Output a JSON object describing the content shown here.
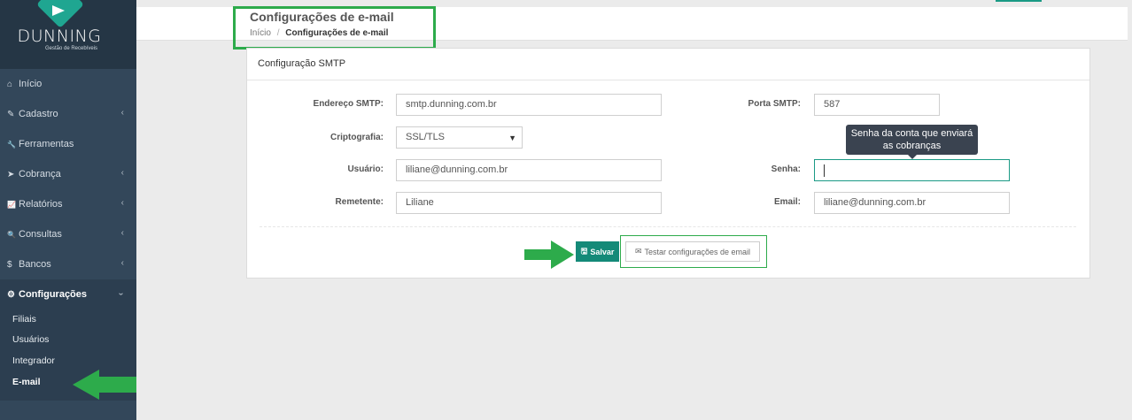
{
  "brand": {
    "name": "DUNNING",
    "tagline": "Gestão de Recebíveis"
  },
  "sidebar": {
    "items": [
      {
        "label": "Início",
        "icon": "home-icon",
        "glyph": "⌂",
        "chevron": ""
      },
      {
        "label": "Cadastro",
        "icon": "edit-icon",
        "glyph": "✎",
        "chevron": "‹"
      },
      {
        "label": "Ferramentas",
        "icon": "wrench-icon",
        "glyph": "🔧",
        "chevron": ""
      },
      {
        "label": "Cobrança",
        "icon": "send-icon",
        "glyph": "➤",
        "chevron": "‹"
      },
      {
        "label": "Relatórios",
        "icon": "chart-icon",
        "glyph": "📈",
        "chevron": "‹"
      },
      {
        "label": "Consultas",
        "icon": "search-icon",
        "glyph": "🔍",
        "chevron": "‹"
      },
      {
        "label": "Bancos",
        "icon": "dollar-icon",
        "glyph": "$",
        "chevron": "‹"
      },
      {
        "label": "Configurações",
        "icon": "gear-icon",
        "glyph": "⚙",
        "chevron": "›"
      }
    ],
    "sub_items": [
      "Filiais",
      "Usuários",
      "Integrador",
      "E-mail"
    ]
  },
  "header": {
    "title": "Configurações de e-mail",
    "breadcrumb_home": "Início",
    "breadcrumb_sep": "/",
    "breadcrumb_current": "Configurações de e-mail"
  },
  "panel": {
    "title": "Configuração SMTP",
    "fields": {
      "smtp_address": {
        "label": "Endereço SMTP:",
        "value": "smtp.dunning.com.br"
      },
      "smtp_port": {
        "label": "Porta SMTP:",
        "value": "587"
      },
      "encryption": {
        "label": "Criptografia:",
        "value": "SSL/TLS"
      },
      "user": {
        "label": "Usuário:",
        "value": "liliane@dunning.com.br"
      },
      "password": {
        "label": "Senha:",
        "value": ""
      },
      "sender": {
        "label": "Remetente:",
        "value": "Liliane"
      },
      "email": {
        "label": "Email:",
        "value": "liliane@dunning.com.br"
      }
    },
    "tooltip_line1": "Senha da conta que enviará",
    "tooltip_line2": "as cobranças",
    "save_label": "Salvar",
    "test_label": "Testar configurações de email"
  },
  "colors": {
    "accent": "#148a78",
    "highlight": "#2dab4b",
    "sidebar": "#33475a"
  }
}
